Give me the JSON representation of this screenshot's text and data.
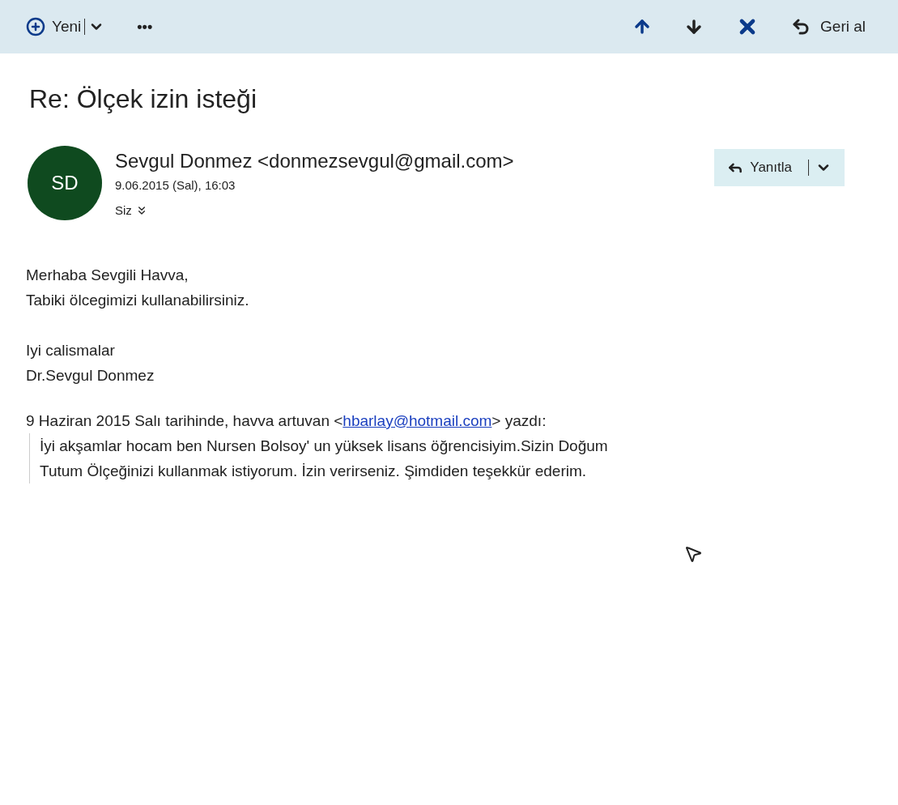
{
  "toolbar": {
    "new_label": "Yeni",
    "more_label": "•••",
    "undo_label": "Geri al"
  },
  "message": {
    "subject": "Re: Ölçek izin isteği",
    "avatar_initials": "SD",
    "sender": "Sevgul Donmez <donmezsevgul@gmail.com>",
    "date": "9.06.2015 (Sal), 16:03",
    "recipient": "Siz",
    "reply_label": "Yanıtla",
    "body": [
      [
        "Merhaba Sevgili Havva,",
        "Tabiki ölcegimizi kullanabilirsiniz."
      ],
      [
        "Iyi calismalar",
        "Dr.Sevgul Donmez"
      ]
    ],
    "quote_intro_before": "9 Haziran 2015 Salı tarihinde, havva artuvan <",
    "quote_link": "hbarlay@hotmail.com",
    "quote_intro_after": "> yazdı:",
    "quote": [
      "İyi akşamlar hocam ben Nursen Bolsoy' un yüksek lisans öğrencisiyim.Sizin Doğum",
      "Tutum Ölçeğinizi kullanmak istiyorum. İzin verirseniz. Şimdiden teşekkür ederim."
    ]
  }
}
